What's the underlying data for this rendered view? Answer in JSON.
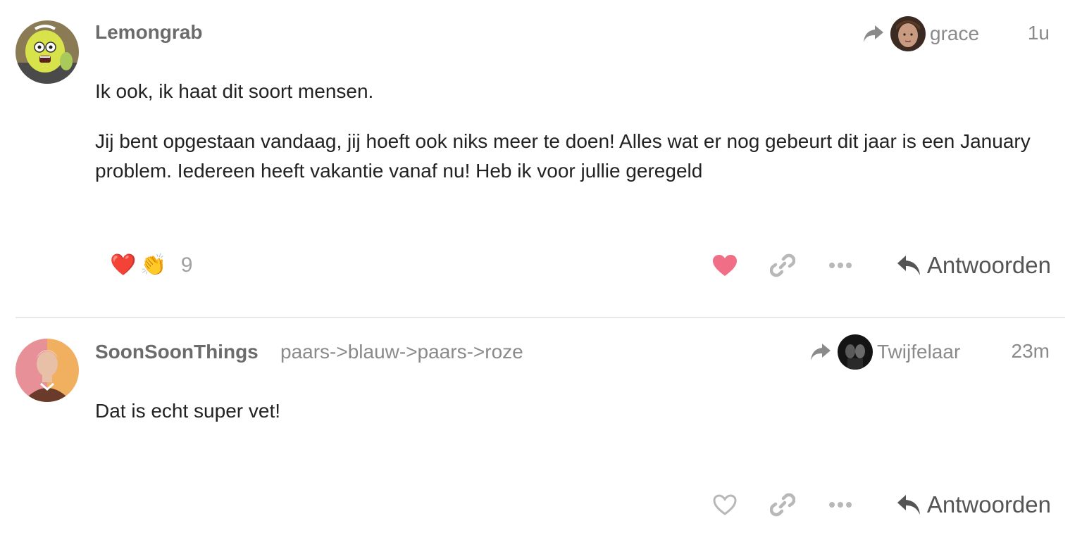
{
  "posts": [
    {
      "username": "Lemongrab",
      "user_title": "",
      "avatar_icon": "lemongrab-avatar",
      "reply_to": {
        "name": "grace",
        "avatar_icon": "grace-avatar"
      },
      "date": "1u",
      "paragraphs": [
        "Ik ook, ik haat dit soort mensen.",
        "Jij bent opgestaan vandaag, jij hoeft ook niks meer te doen! Alles wat er nog gebeurt dit jaar is een January problem. Iedereen heeft vakantie vanaf nu! Heb ik voor jullie geregeld"
      ],
      "reactions": {
        "emojis": [
          "❤️",
          "👏"
        ],
        "count": "9"
      },
      "liked": true,
      "reply_label": "Antwoorden"
    },
    {
      "username": "SoonSoonThings",
      "user_title": "paars->blauw->paars->roze",
      "avatar_icon": "soonsoonthings-avatar",
      "reply_to": {
        "name": "Twijfelaar",
        "avatar_icon": "twijfelaar-avatar"
      },
      "date": "23m",
      "paragraphs": [
        "Dat is echt super vet!"
      ],
      "liked": false,
      "reply_label": "Antwoorden"
    }
  ],
  "colors": {
    "like_active": "#f06e86",
    "icon_gray": "#b8b8b8",
    "text_muted": "#8a8a8a",
    "reply_text": "#555555"
  }
}
